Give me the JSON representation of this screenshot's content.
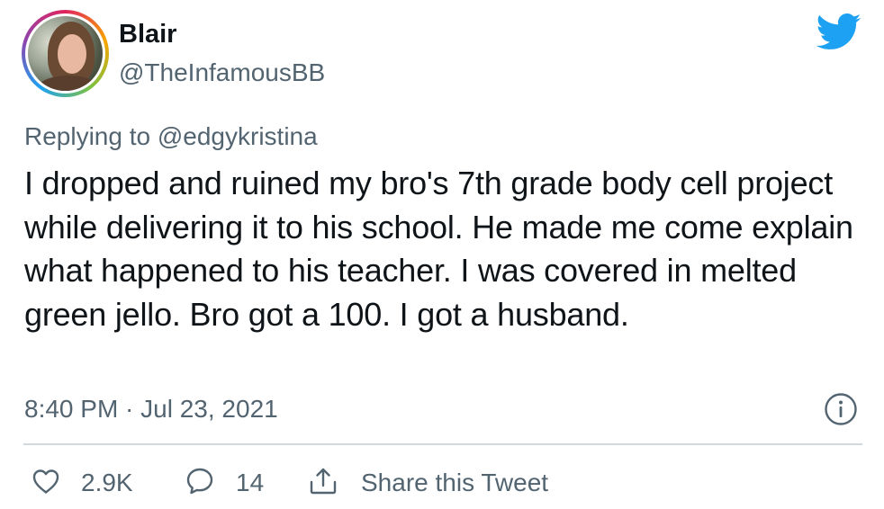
{
  "user": {
    "display_name": "Blair",
    "handle": "@TheInfamousBB"
  },
  "icons": {
    "logo": "twitter-bird-icon",
    "info": "info-icon",
    "like": "heart-icon",
    "reply": "comment-bubble-icon",
    "share": "share-icon"
  },
  "colors": {
    "brand": "#1da1f2",
    "text": "#0f1419",
    "secondary": "#536471",
    "divider": "#cfd9de"
  },
  "tweet": {
    "replying_to": "Replying to @edgykristina",
    "text": "I dropped and ruined my bro's 7th grade body cell project while delivering it to his school. He made me come explain what happened to his teacher. I was covered in melted green jello. Bro got a 100. I got a husband.",
    "timestamp": "8:40 PM · Jul 23, 2021"
  },
  "actions": {
    "like_count": "2.9K",
    "reply_count": "14",
    "share_label": "Share this Tweet"
  }
}
